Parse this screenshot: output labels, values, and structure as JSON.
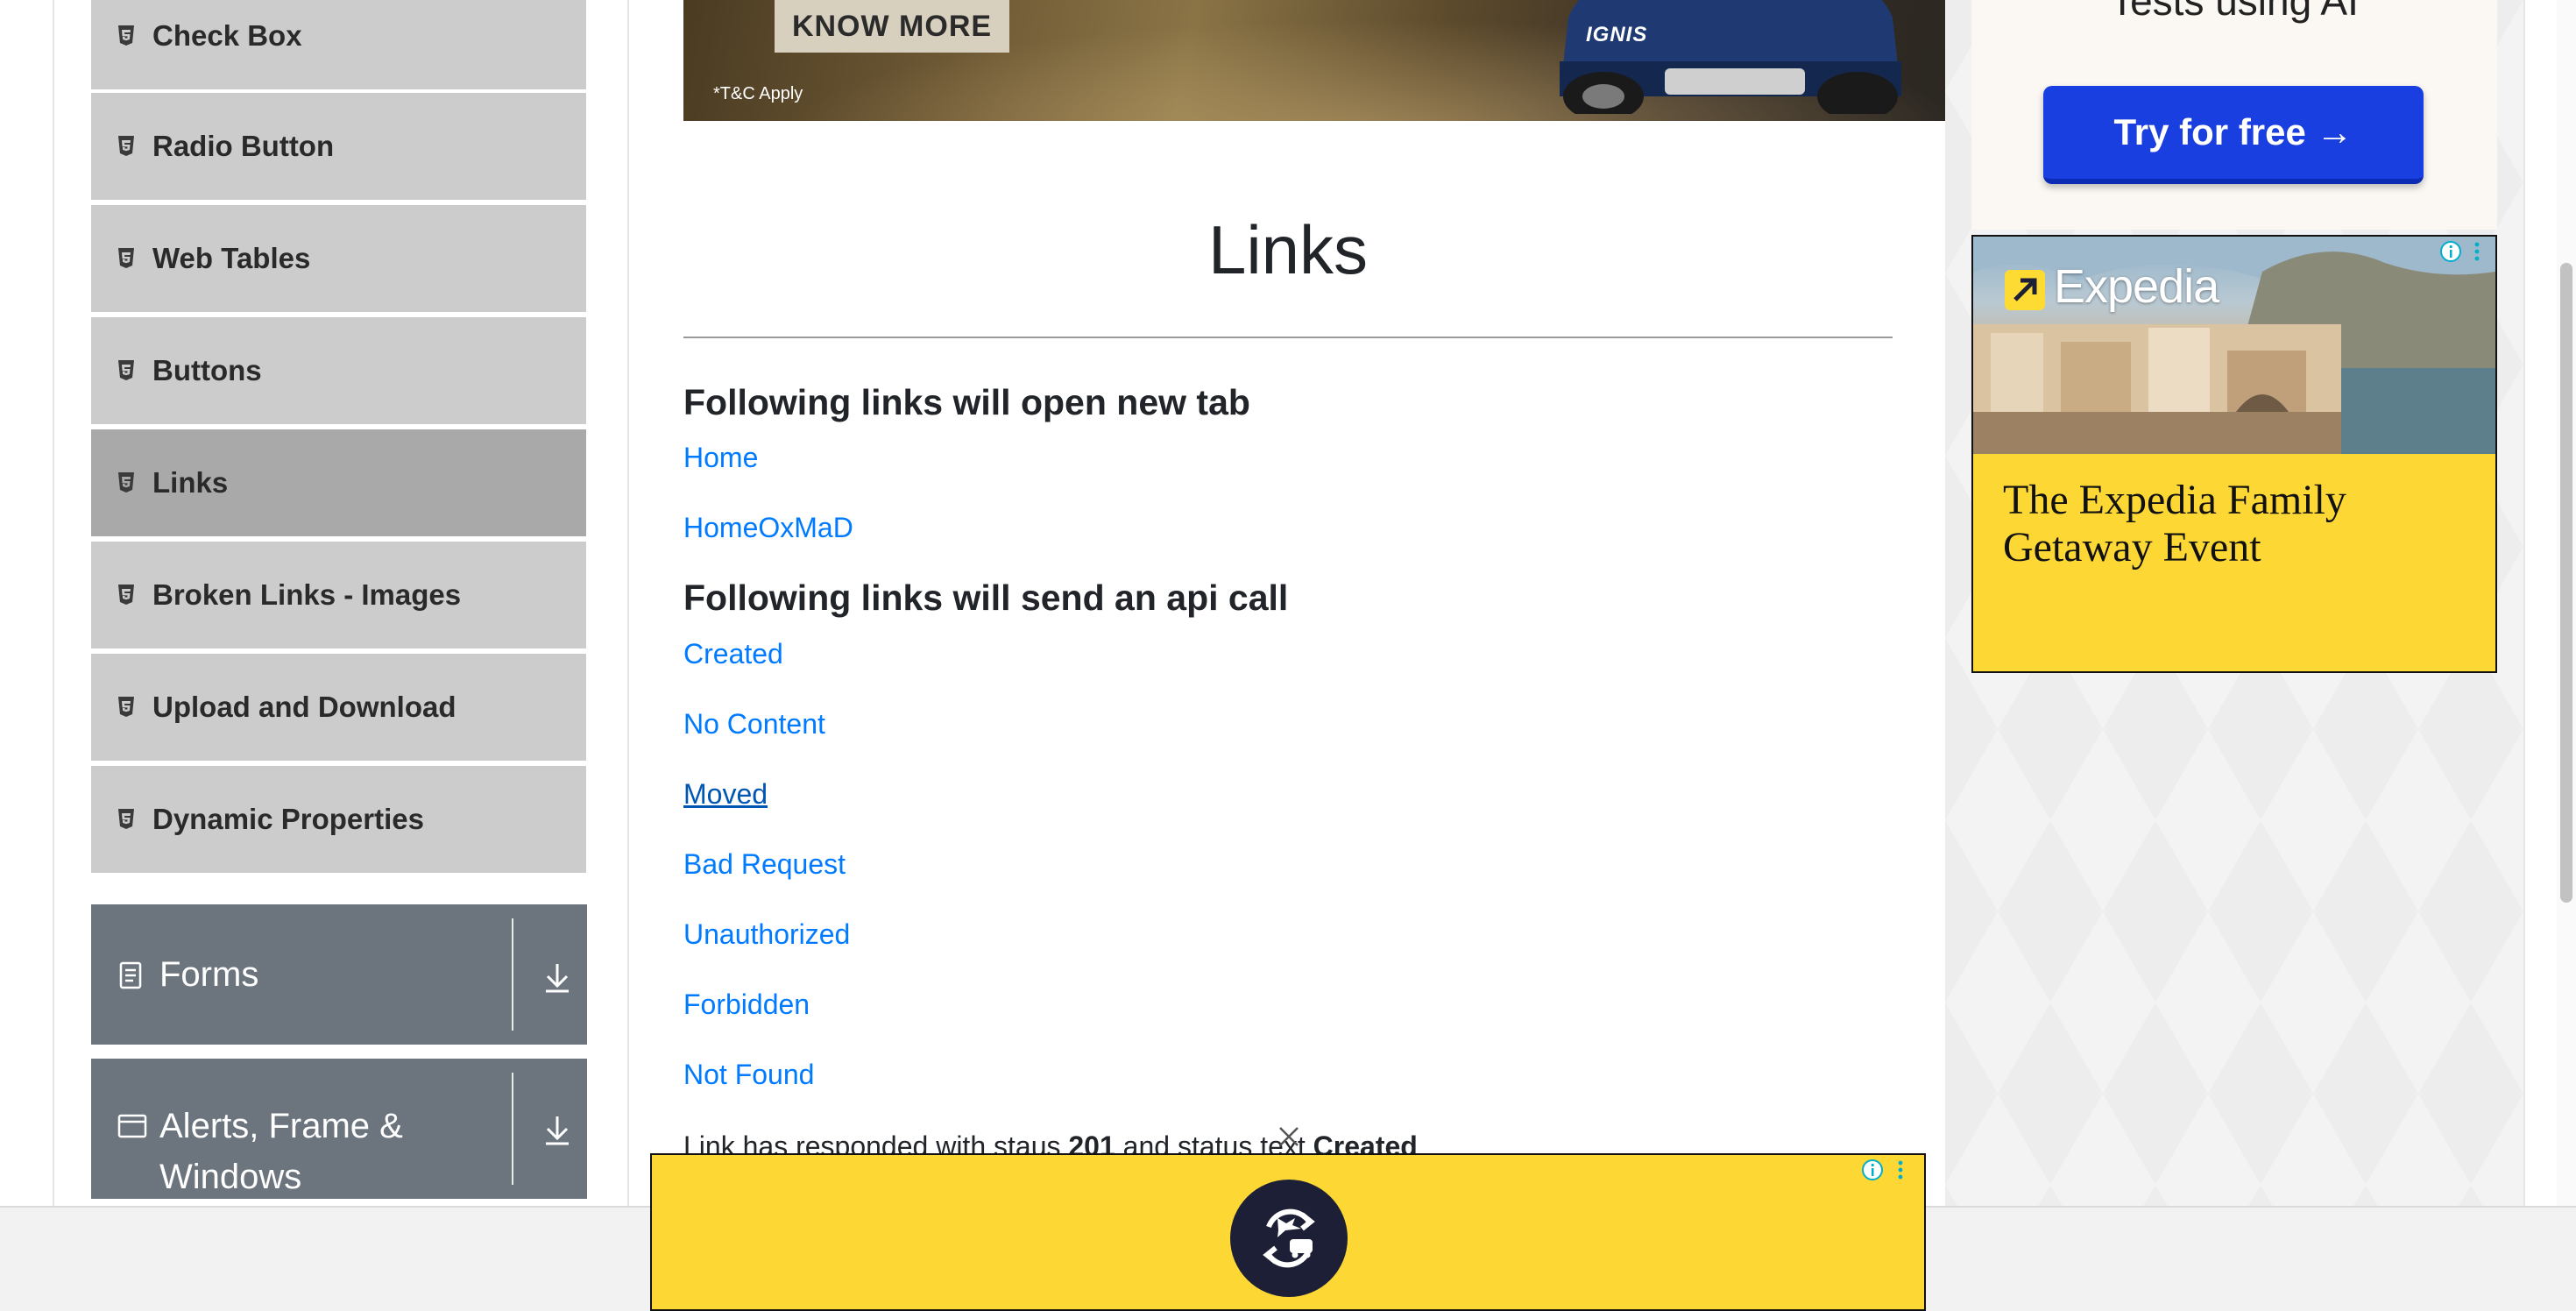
{
  "sidebar": {
    "items": [
      {
        "label": "Check Box",
        "icon": "html5-icon"
      },
      {
        "label": "Radio Button",
        "icon": "html5-icon"
      },
      {
        "label": "Web Tables",
        "icon": "html5-icon"
      },
      {
        "label": "Buttons",
        "icon": "html5-icon"
      },
      {
        "label": "Links",
        "icon": "html5-icon",
        "active": true
      },
      {
        "label": "Broken Links - Images",
        "icon": "html5-icon"
      },
      {
        "label": "Upload and Download",
        "icon": "html5-icon"
      },
      {
        "label": "Dynamic Properties",
        "icon": "html5-icon"
      }
    ],
    "groups": [
      {
        "label": "Forms",
        "icon": "document-icon",
        "toggle_icon": "download-arrow-icon"
      },
      {
        "label_line1": "Alerts, Frame &",
        "label_line2": "Windows",
        "icon": "browser-window-icon",
        "toggle_icon": "download-arrow-icon"
      }
    ]
  },
  "banner_ad": {
    "cta": "KNOW MORE",
    "disclaimer": "*T&C Apply",
    "car_badge": "IGNIS"
  },
  "main": {
    "title": "Links",
    "heading_new_tab": "Following links will open new tab",
    "new_tab_links": [
      "Home",
      "HomeOxMaD"
    ],
    "heading_api": "Following links will send an api call",
    "api_links": [
      "Created",
      "No Content",
      "Moved",
      "Bad Request",
      "Unauthorized",
      "Forbidden",
      "Not Found"
    ],
    "response": {
      "prefix": "Link has responded with staus ",
      "status_code": "201",
      "middle": " and status text ",
      "status_text": "Created"
    }
  },
  "right_ads": {
    "ai_ad": {
      "headline": "Tests using AI",
      "button": "Try for free →"
    },
    "expedia_ad": {
      "brand": "Expedia",
      "text": "The Expedia Family Getaway Event"
    }
  },
  "colors": {
    "link": "#007bff",
    "sidebar_item_bg": "#cccccc",
    "sidebar_active_bg": "#a9a9a9",
    "group_header_bg": "#6c757d",
    "ad_yellow": "#fdd835",
    "cta_blue": "#1a3fe0"
  }
}
